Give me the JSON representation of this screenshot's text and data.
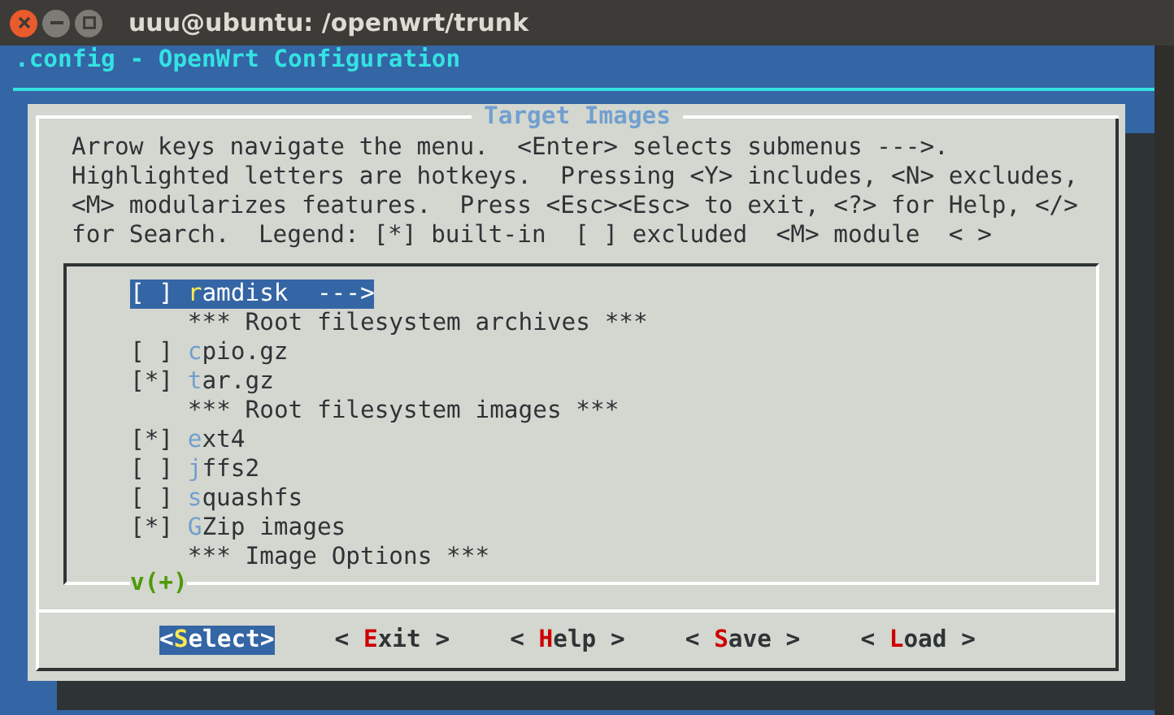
{
  "window": {
    "title": "uuu@ubuntu: /openwrt/trunk"
  },
  "header": {
    "title": ".config - OpenWrt Configuration"
  },
  "dialog": {
    "title": "Target Images",
    "help_lines": [
      "Arrow keys navigate the menu.  <Enter> selects submenus --->.",
      "Highlighted letters are hotkeys.  Pressing <Y> includes, <N> excludes,",
      "<M> modularizes features.  Press <Esc><Esc> to exit, <?> for Help, </>",
      "for Search.  Legend: [*] built-in  [ ] excluded  <M> module  < >"
    ],
    "menu": [
      {
        "kind": "option",
        "box": "[ ]",
        "hotkey": "r",
        "rest": "amdisk",
        "submenu": "--->",
        "selected": true
      },
      {
        "kind": "comment",
        "text": "*** Root filesystem archives ***"
      },
      {
        "kind": "option",
        "box": "[ ]",
        "hotkey": "c",
        "rest": "pio.gz",
        "selected": false
      },
      {
        "kind": "option",
        "box": "[*]",
        "hotkey": "t",
        "rest": "ar.gz",
        "selected": false
      },
      {
        "kind": "comment",
        "text": "*** Root filesystem images ***"
      },
      {
        "kind": "option",
        "box": "[*]",
        "hotkey": "e",
        "rest": "xt4",
        "selected": false
      },
      {
        "kind": "option",
        "box": "[ ]",
        "hotkey": "j",
        "rest": "ffs2",
        "selected": false
      },
      {
        "kind": "option",
        "box": "[ ]",
        "hotkey": "s",
        "rest": "quashfs",
        "selected": false
      },
      {
        "kind": "option",
        "box": "[*]",
        "hotkey": "G",
        "rest": "Zip images",
        "selected": false
      },
      {
        "kind": "comment",
        "text": "*** Image Options ***"
      }
    ],
    "more_indicator": "v(+)",
    "buttons": [
      {
        "prefix": "<",
        "hotkey": "S",
        "rest": "elect>",
        "selected": true
      },
      {
        "prefix": "< ",
        "hotkey": "E",
        "rest": "xit >",
        "selected": false
      },
      {
        "prefix": "< ",
        "hotkey": "H",
        "rest": "elp >",
        "selected": false
      },
      {
        "prefix": "< ",
        "hotkey": "S",
        "rest": "ave >",
        "selected": false
      },
      {
        "prefix": "< ",
        "hotkey": "L",
        "rest": "oad >",
        "selected": false
      }
    ]
  }
}
